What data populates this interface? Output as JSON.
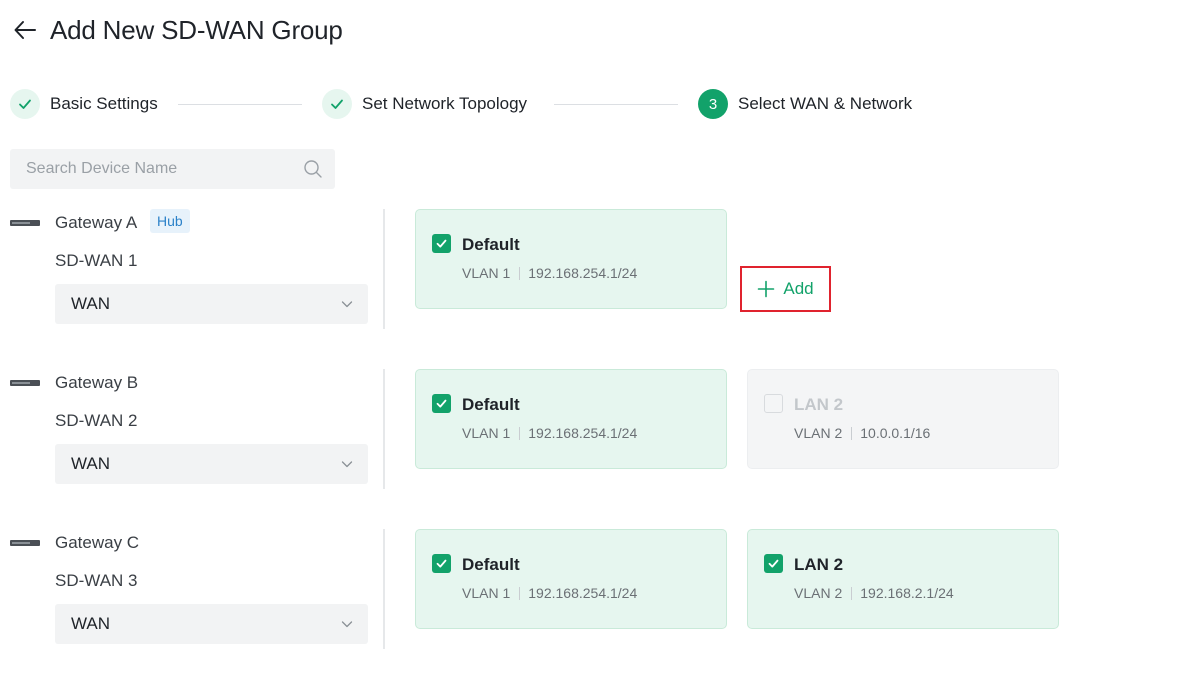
{
  "page": {
    "title": "Add New SD-WAN Group"
  },
  "steps": [
    {
      "label": "Basic Settings",
      "state": "done"
    },
    {
      "label": "Set Network Topology",
      "state": "done"
    },
    {
      "label": "Select WAN & Network",
      "state": "active",
      "number": "3"
    }
  ],
  "search": {
    "placeholder": "Search Device Name",
    "value": ""
  },
  "gateways": [
    {
      "name": "Gateway A",
      "badge": "Hub",
      "sdwan": "SD-WAN 1",
      "wan": "WAN",
      "networks": [
        {
          "name": "Default",
          "vlan": "VLAN 1",
          "subnet": "192.168.254.1/24",
          "checked": true,
          "enabled": true
        }
      ],
      "add_label": "Add"
    },
    {
      "name": "Gateway B",
      "sdwan": "SD-WAN 2",
      "wan": "WAN",
      "networks": [
        {
          "name": "Default",
          "vlan": "VLAN 1",
          "subnet": "192.168.254.1/24",
          "checked": true,
          "enabled": true
        },
        {
          "name": "LAN 2",
          "vlan": "VLAN 2",
          "subnet": "10.0.0.1/16",
          "checked": false,
          "enabled": false
        }
      ]
    },
    {
      "name": "Gateway C",
      "sdwan": "SD-WAN 3",
      "wan": "WAN",
      "networks": [
        {
          "name": "Default",
          "vlan": "VLAN 1",
          "subnet": "192.168.254.1/24",
          "checked": true,
          "enabled": true
        },
        {
          "name": "LAN 2",
          "vlan": "VLAN 2",
          "subnet": "192.168.2.1/24",
          "checked": true,
          "enabled": true
        }
      ]
    }
  ],
  "colors": {
    "accent": "#12a26a",
    "accent_bg": "#e6f6ef",
    "highlight_border": "#e0232e",
    "hub_badge": "#2c82c9"
  },
  "icons": {
    "back": "arrow-left-icon",
    "search": "search-icon",
    "check": "check-icon",
    "chevron": "chevron-down-icon",
    "plus": "plus-icon",
    "device": "gateway-device-icon"
  }
}
